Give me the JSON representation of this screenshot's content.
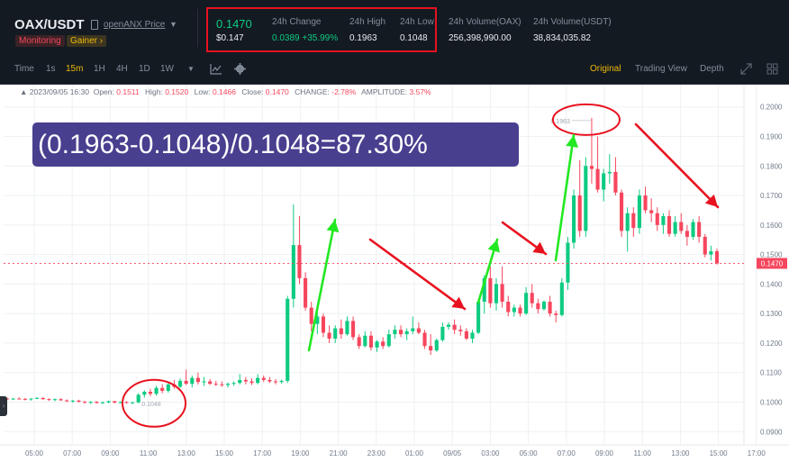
{
  "header": {
    "pair": "OAX/USDT",
    "price_link": "openANX Price",
    "tags": {
      "monitoring": "Monitoring",
      "gainer": "Gainer ›"
    },
    "last_price": "0.1470",
    "last_price_usd": "$0.147",
    "change_label": "24h Change",
    "change_value": "0.0389 +35.99%",
    "high_label": "24h High",
    "high_value": "0.1963",
    "low_label": "24h Low",
    "low_value": "0.1048",
    "vol_oax_label": "24h Volume(OAX)",
    "vol_oax_value": "256,398,990.00",
    "vol_usdt_label": "24h Volume(USDT)",
    "vol_usdt_value": "38,834,035.82"
  },
  "toolbar": {
    "time_label": "Time",
    "intervals": [
      "1s",
      "15m",
      "1H",
      "4H",
      "1D",
      "1W"
    ],
    "active_interval": "15m",
    "views": [
      "Original",
      "Trading View",
      "Depth"
    ],
    "active_view": "Original"
  },
  "ohlc_bar": {
    "datetime": "2023/09/05 16:30",
    "open_label": "Open:",
    "open": "0.1511",
    "high_label": "High:",
    "high": "0.1520",
    "low_label": "Low:",
    "low": "0.1466",
    "close_label": "Close:",
    "close": "0.1470",
    "change_label": "CHANGE:",
    "change": "-2.78%",
    "amplitude_label": "AMPLITUDE:",
    "amplitude": "3.57%"
  },
  "annotation": {
    "formula": "(0.1963-0.1048)/0.1048=87.30%",
    "high_marker": "0.1963",
    "low_marker": "0.1048"
  },
  "colors": {
    "up": "#0ecb81",
    "down": "#f6465d",
    "accent": "#f0b90b",
    "arrow_green": "#22e822",
    "arrow_red": "#e8121f"
  },
  "chart_data": {
    "type": "candlestick",
    "x_ticks": [
      "05:00",
      "07:00",
      "09:00",
      "11:00",
      "13:00",
      "15:00",
      "17:00",
      "19:00",
      "21:00",
      "23:00",
      "01:00",
      "09/05",
      "03:00",
      "05:00",
      "07:00",
      "09:00",
      "11:00",
      "13:00",
      "15:00",
      "17:00"
    ],
    "y_ticks": [
      "0.2000",
      "0.1900",
      "0.1800",
      "0.1700",
      "0.1600",
      "0.1500",
      "0.1400",
      "0.1300",
      "0.1200",
      "0.1100",
      "0.1000",
      "0.0900"
    ],
    "ylim": [
      0.0855,
      0.2045
    ],
    "current_price_label": "0.1470",
    "grid": true,
    "candles": [
      [
        0.1012,
        0.1015,
        0.1008,
        0.101
      ],
      [
        0.101,
        0.1014,
        0.1007,
        0.1012
      ],
      [
        0.1012,
        0.1016,
        0.1009,
        0.1011
      ],
      [
        0.1011,
        0.1014,
        0.1006,
        0.1009
      ],
      [
        0.1009,
        0.1013,
        0.1005,
        0.1012
      ],
      [
        0.1012,
        0.1017,
        0.101,
        0.1014
      ],
      [
        0.1014,
        0.1016,
        0.1008,
        0.101
      ],
      [
        0.101,
        0.1013,
        0.1004,
        0.1007
      ],
      [
        0.1007,
        0.1012,
        0.1003,
        0.101
      ],
      [
        0.101,
        0.1013,
        0.1004,
        0.1006
      ],
      [
        0.1006,
        0.1009,
        0.1,
        0.1003
      ],
      [
        0.1003,
        0.1007,
        0.0998,
        0.1005
      ],
      [
        0.1005,
        0.1008,
        0.0999,
        0.1001
      ],
      [
        0.1001,
        0.1004,
        0.0995,
        0.0998
      ],
      [
        0.0998,
        0.1003,
        0.0993,
        0.1001
      ],
      [
        0.1001,
        0.1003,
        0.0995,
        0.0997
      ],
      [
        0.0997,
        0.1002,
        0.0994,
        0.0999
      ],
      [
        0.0999,
        0.1005,
        0.0996,
        0.1003
      ],
      [
        0.1003,
        0.1004,
        0.0996,
        0.0998
      ],
      [
        0.0998,
        0.1003,
        0.0995,
        0.1
      ],
      [
        0.1,
        0.1003,
        0.0995,
        0.0997
      ],
      [
        0.0997,
        0.1001,
        0.0994,
        0.0999
      ],
      [
        0.0999,
        0.103,
        0.0996,
        0.1025
      ],
      [
        0.1025,
        0.104,
        0.1015,
        0.1035
      ],
      [
        0.1035,
        0.1045,
        0.102,
        0.1028
      ],
      [
        0.1028,
        0.1055,
        0.1022,
        0.1048
      ],
      [
        0.1048,
        0.106,
        0.103,
        0.1038
      ],
      [
        0.1038,
        0.1068,
        0.1032,
        0.106
      ],
      [
        0.106,
        0.1075,
        0.1045,
        0.1052
      ],
      [
        0.1052,
        0.108,
        0.1048,
        0.1072
      ],
      [
        0.1072,
        0.111,
        0.1058,
        0.1062
      ],
      [
        0.1062,
        0.109,
        0.105,
        0.1082
      ],
      [
        0.1082,
        0.11,
        0.106,
        0.1068
      ],
      [
        0.1068,
        0.1085,
        0.1055,
        0.107
      ],
      [
        0.107,
        0.1078,
        0.1058,
        0.1062
      ],
      [
        0.1062,
        0.1072,
        0.1055,
        0.106
      ],
      [
        0.106,
        0.107,
        0.1052,
        0.1058
      ],
      [
        0.1058,
        0.1066,
        0.105,
        0.1062
      ],
      [
        0.1062,
        0.107,
        0.1055,
        0.1065
      ],
      [
        0.1065,
        0.1095,
        0.106,
        0.1075
      ],
      [
        0.1075,
        0.1085,
        0.106,
        0.107
      ],
      [
        0.107,
        0.108,
        0.1058,
        0.1065
      ],
      [
        0.1065,
        0.1095,
        0.106,
        0.1082
      ],
      [
        0.1082,
        0.109,
        0.1068,
        0.1075
      ],
      [
        0.1075,
        0.1085,
        0.1065,
        0.107
      ],
      [
        0.107,
        0.1078,
        0.106,
        0.1068
      ],
      [
        0.1068,
        0.1076,
        0.1062,
        0.1072
      ],
      [
        0.1072,
        0.136,
        0.1065,
        0.135
      ],
      [
        0.135,
        0.167,
        0.132,
        0.1532
      ],
      [
        0.1532,
        0.163,
        0.14,
        0.142
      ],
      [
        0.142,
        0.144,
        0.131,
        0.132
      ],
      [
        0.132,
        0.134,
        0.124,
        0.1265
      ],
      [
        0.1265,
        0.131,
        0.123,
        0.129
      ],
      [
        0.129,
        0.13,
        0.122,
        0.1235
      ],
      [
        0.1235,
        0.126,
        0.12,
        0.1215
      ],
      [
        0.1215,
        0.126,
        0.12,
        0.125
      ],
      [
        0.125,
        0.128,
        0.1215,
        0.123
      ],
      [
        0.123,
        0.129,
        0.1225,
        0.1275
      ],
      [
        0.1275,
        0.129,
        0.121,
        0.122
      ],
      [
        0.122,
        0.123,
        0.118,
        0.119
      ],
      [
        0.119,
        0.124,
        0.1185,
        0.1225
      ],
      [
        0.1225,
        0.124,
        0.1175,
        0.1185
      ],
      [
        0.1185,
        0.121,
        0.117,
        0.1205
      ],
      [
        0.1205,
        0.122,
        0.118,
        0.119
      ],
      [
        0.119,
        0.1245,
        0.1185,
        0.123
      ],
      [
        0.123,
        0.126,
        0.1215,
        0.1245
      ],
      [
        0.1245,
        0.126,
        0.122,
        0.123
      ],
      [
        0.123,
        0.125,
        0.121,
        0.124
      ],
      [
        0.124,
        0.129,
        0.123,
        0.125
      ],
      [
        0.125,
        0.127,
        0.123,
        0.1235
      ],
      [
        0.1235,
        0.1245,
        0.118,
        0.119
      ],
      [
        0.119,
        0.123,
        0.116,
        0.1175
      ],
      [
        0.1175,
        0.1215,
        0.117,
        0.121
      ],
      [
        0.121,
        0.127,
        0.1205,
        0.1255
      ],
      [
        0.1255,
        0.127,
        0.1245,
        0.1262
      ],
      [
        0.1262,
        0.128,
        0.123,
        0.1245
      ],
      [
        0.1245,
        0.126,
        0.1225,
        0.124
      ],
      [
        0.124,
        0.125,
        0.121,
        0.1215
      ],
      [
        0.1215,
        0.1245,
        0.12,
        0.1235
      ],
      [
        0.1235,
        0.135,
        0.123,
        0.134
      ],
      [
        0.134,
        0.143,
        0.13,
        0.142
      ],
      [
        0.142,
        0.146,
        0.132,
        0.1335
      ],
      [
        0.1335,
        0.142,
        0.131,
        0.14
      ],
      [
        0.14,
        0.146,
        0.132,
        0.134
      ],
      [
        0.134,
        0.136,
        0.129,
        0.1305
      ],
      [
        0.1305,
        0.133,
        0.129,
        0.132
      ],
      [
        0.132,
        0.133,
        0.129,
        0.13
      ],
      [
        0.13,
        0.139,
        0.1295,
        0.137
      ],
      [
        0.137,
        0.14,
        0.132,
        0.1335
      ],
      [
        0.1335,
        0.135,
        0.13,
        0.1315
      ],
      [
        0.1315,
        0.1345,
        0.131,
        0.134
      ],
      [
        0.134,
        0.136,
        0.129,
        0.13
      ],
      [
        0.13,
        0.131,
        0.127,
        0.1295
      ],
      [
        0.1295,
        0.142,
        0.129,
        0.1405
      ],
      [
        0.1405,
        0.156,
        0.138,
        0.154
      ],
      [
        0.154,
        0.172,
        0.152,
        0.17
      ],
      [
        0.17,
        0.182,
        0.156,
        0.158
      ],
      [
        0.158,
        0.183,
        0.156,
        0.18
      ],
      [
        0.18,
        0.1963,
        0.174,
        0.179
      ],
      [
        0.179,
        0.19,
        0.171,
        0.172
      ],
      [
        0.172,
        0.179,
        0.168,
        0.1775
      ],
      [
        0.1775,
        0.184,
        0.174,
        0.178
      ],
      [
        0.178,
        0.183,
        0.17,
        0.171
      ],
      [
        0.171,
        0.172,
        0.156,
        0.158
      ],
      [
        0.158,
        0.166,
        0.151,
        0.164
      ],
      [
        0.164,
        0.166,
        0.156,
        0.159
      ],
      [
        0.159,
        0.172,
        0.157,
        0.17
      ],
      [
        0.17,
        0.173,
        0.164,
        0.165
      ],
      [
        0.165,
        0.169,
        0.161,
        0.164
      ],
      [
        0.164,
        0.166,
        0.158,
        0.16
      ],
      [
        0.16,
        0.164,
        0.157,
        0.163
      ],
      [
        0.163,
        0.165,
        0.156,
        0.157
      ],
      [
        0.157,
        0.163,
        0.156,
        0.161
      ],
      [
        0.161,
        0.164,
        0.157,
        0.158
      ],
      [
        0.158,
        0.16,
        0.153,
        0.156
      ],
      [
        0.156,
        0.162,
        0.155,
        0.161
      ],
      [
        0.161,
        0.163,
        0.154,
        0.156
      ],
      [
        0.156,
        0.157,
        0.149,
        0.15
      ],
      [
        0.15,
        0.153,
        0.148,
        0.1511
      ],
      [
        0.1511,
        0.152,
        0.1466,
        0.147
      ]
    ]
  }
}
